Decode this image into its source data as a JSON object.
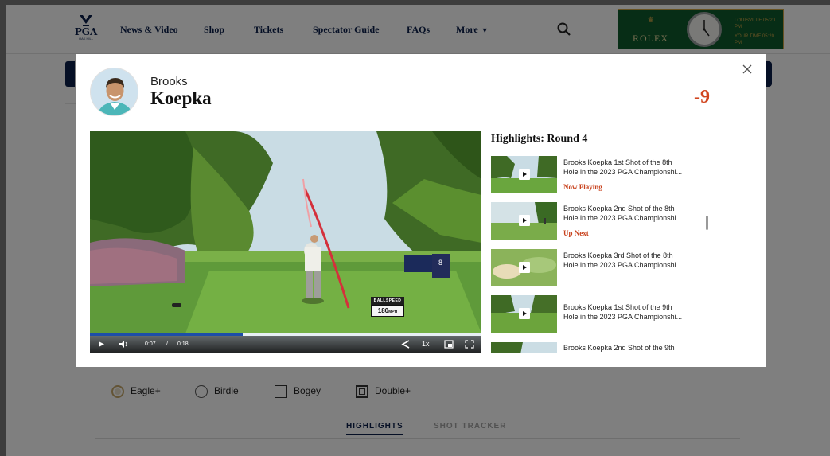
{
  "nav": {
    "logo_text": "PGA",
    "logo_sub": "OAK HILL",
    "items": [
      "News & Video",
      "Shop",
      "Tickets",
      "Spectator Guide",
      "FAQs",
      "More"
    ],
    "search_icon": "search-icon"
  },
  "rolex": {
    "brand": "ROLEX",
    "line1": "LOUISVILLE 05:20 PM",
    "line2": "YOUR TIME 05:20 PM"
  },
  "legend": {
    "eagle": "Eagle+",
    "birdie": "Birdie",
    "bogey": "Bogey",
    "double": "Double+"
  },
  "tabs": {
    "highlights": "HIGHLIGHTS",
    "shot_tracker": "SHOT TRACKER"
  },
  "modal": {
    "player_first": "Brooks",
    "player_last": "Koepka",
    "score": "-9",
    "close_icon": "close-icon",
    "video": {
      "current_time": "0:07",
      "separator": "/",
      "duration": "0:18",
      "progress": 0.39,
      "speed": "1x",
      "ballspeed_label": "BALLSPEED",
      "ballspeed_value": "180",
      "ballspeed_unit": "MPH",
      "hole_number": "8"
    },
    "highlights": {
      "title": "Highlights: Round 4",
      "items": [
        {
          "line1": "Brooks Koepka 1st Shot of the 8th",
          "line2": "Hole in the 2023 PGA Championshi...",
          "status": "Now Playing"
        },
        {
          "line1": "Brooks Koepka 2nd Shot of the 8th",
          "line2": "Hole in the 2023 PGA Championshi...",
          "status": "Up Next"
        },
        {
          "line1": "Brooks Koepka 3rd Shot of the 8th",
          "line2": "Hole in the 2023 PGA Championshi...",
          "status": ""
        },
        {
          "line1": "Brooks Koepka 1st Shot of the 9th",
          "line2": "Hole in the 2023 PGA Championshi...",
          "status": ""
        },
        {
          "line1": "Brooks Koepka 2nd Shot of the 9th",
          "line2": "",
          "status": ""
        }
      ]
    }
  },
  "colors": {
    "navy": "#0b1f4a",
    "score_red": "#d1451f",
    "status_red": "#c8421d",
    "rolex_green": "#0f5a2d",
    "rolex_gold": "#cfa447"
  }
}
